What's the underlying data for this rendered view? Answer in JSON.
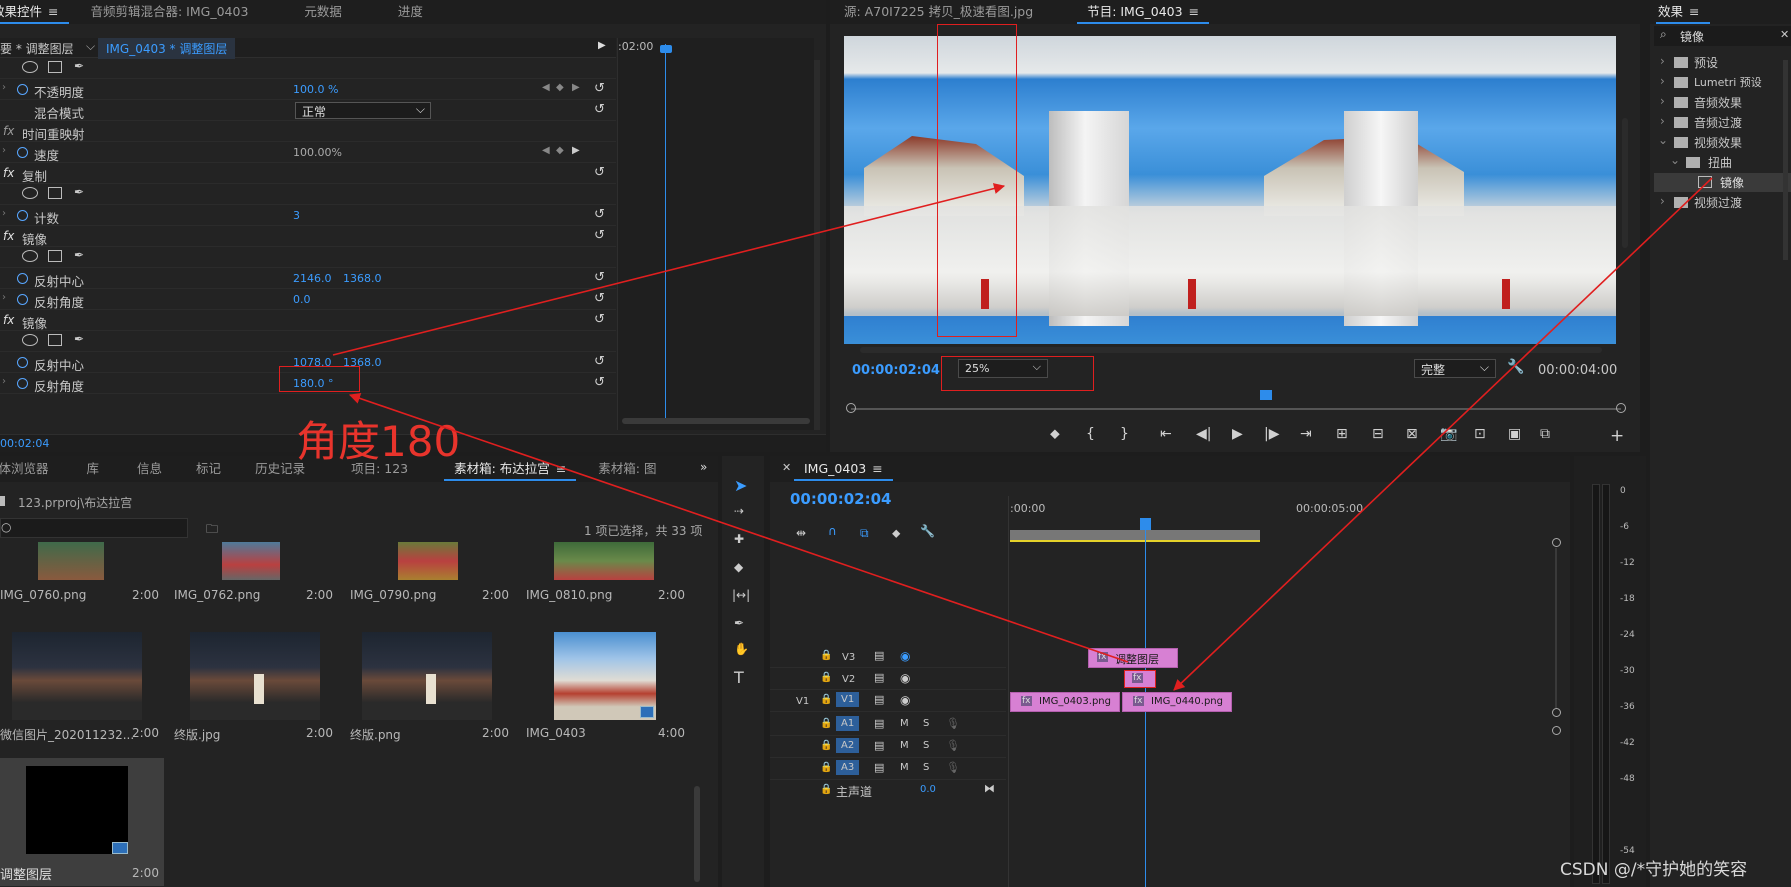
{
  "effect_controls": {
    "tabs": [
      "效果控件",
      "音频剪辑混合器: IMG_0403",
      "元数据",
      "进度"
    ],
    "breadcrumb_source": "要 * 调整图层",
    "breadcrumb_clip": "IMG_0403 * 调整图层",
    "ruler_time": ":02:00",
    "rows": {
      "opacity": {
        "label": "不透明度",
        "value": "100.0 %"
      },
      "blend": {
        "label": "混合模式",
        "value": "正常"
      },
      "time_remap": {
        "label": "时间重映射"
      },
      "speed": {
        "label": "速度",
        "value": "100.00%"
      },
      "replicate": {
        "label": "复制"
      },
      "count": {
        "label": "计数",
        "value": "3"
      },
      "mirror1": {
        "label": "镜像"
      },
      "mirror1_center": {
        "label": "反射中心",
        "x": "2146.0",
        "y": "1368.0"
      },
      "mirror1_angle": {
        "label": "反射角度",
        "value": "0.0"
      },
      "mirror2": {
        "label": "镜像"
      },
      "mirror2_center": {
        "label": "反射中心",
        "x": "1078.0",
        "y": "1368.0"
      },
      "mirror2_angle": {
        "label": "反射角度",
        "value": "180.0 °"
      }
    },
    "footer_time": "00:02:04"
  },
  "source_monitor": {
    "source_tab": "源: A70I7225 拷贝_极速看图.jpg",
    "program_tab": "节目: IMG_0403",
    "timecode": "00:00:02:04",
    "zoom": "25%",
    "quality": "完整",
    "duration": "00:00:04:00"
  },
  "effects_panel": {
    "title": "效果",
    "search_value": "镜像",
    "tree": [
      "预设",
      "Lumetri 预设",
      "音频效果",
      "音频过渡",
      "视频效果",
      "扭曲",
      "镜像",
      "视频过渡"
    ]
  },
  "annotation": {
    "angle_note": "角度180"
  },
  "project_panel": {
    "tabs": [
      "媒体浏览器",
      "库",
      "信息",
      "标记",
      "历史记录",
      "项目: 123",
      "素材箱: 布达拉宫",
      "素材箱: 图"
    ],
    "path": "123.prproj\\布达拉宫",
    "selection_info": "1 项已选择，共 33 项",
    "items": [
      {
        "name": "IMG_0760.png",
        "dur": "2:00"
      },
      {
        "name": "IMG_0762.png",
        "dur": "2:00"
      },
      {
        "name": "IMG_0790.png",
        "dur": "2:00"
      },
      {
        "name": "IMG_0810.png",
        "dur": "2:00"
      },
      {
        "name": "微信图片_202011232...",
        "dur": "2:00"
      },
      {
        "name": "终版.jpg",
        "dur": "2:00"
      },
      {
        "name": "终版.png",
        "dur": "2:00"
      },
      {
        "name": "IMG_0403",
        "dur": "4:00"
      },
      {
        "name": "调整图层",
        "dur": "2:00"
      }
    ]
  },
  "timeline": {
    "sequence_name": "IMG_0403",
    "timecode": "00:00:02:04",
    "ruler_start": ":00:00",
    "ruler_mark": "00:00:05:00",
    "tracks": {
      "v3": "V3",
      "v2": "V2",
      "v1": "V1",
      "v1_source": "V1",
      "a1": "A1",
      "a2": "A2",
      "a3": "A3",
      "m": "M",
      "s": "S",
      "master": "主声道",
      "master_value": "0.0"
    },
    "clips": {
      "adjustment": "调整图层",
      "img0403": "IMG_0403.png",
      "img0440": "IMG_0440.png",
      "fx": "fx"
    }
  },
  "meter": {
    "ticks": [
      "0",
      "-6",
      "-12",
      "-18",
      "-24",
      "-30",
      "-36",
      "-42",
      "-48",
      "-54"
    ]
  },
  "watermark": "CSDN @/*守护她的笑容"
}
